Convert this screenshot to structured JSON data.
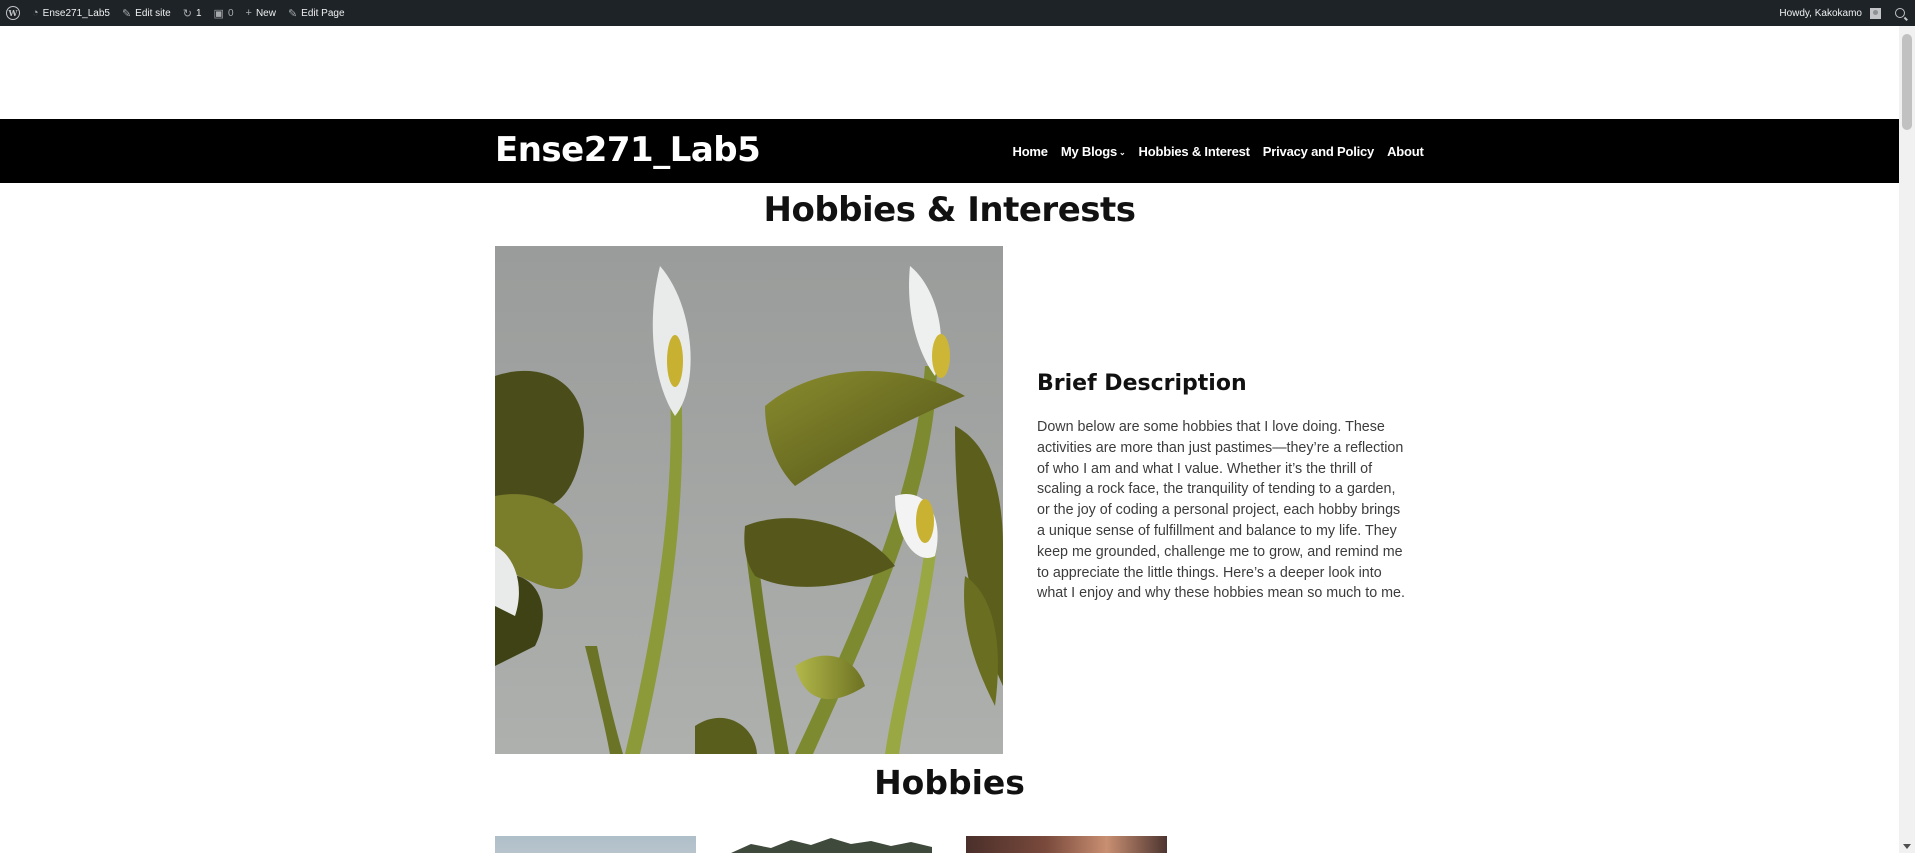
{
  "admin_bar": {
    "site_name": "Ense271_Lab5",
    "edit_site": "Edit site",
    "updates_count": "1",
    "comments_count": "0",
    "new_label": "New",
    "edit_page": "Edit Page",
    "greeting": "Howdy, Kakokamo"
  },
  "header": {
    "site_title": "Ense271_Lab5",
    "nav": [
      {
        "label": "Home"
      },
      {
        "label": "My Blogs"
      },
      {
        "label": "Hobbies & Interest"
      },
      {
        "label": "Privacy and Policy"
      },
      {
        "label": "About"
      }
    ]
  },
  "main": {
    "page_title": "Hobbies & Interests",
    "description_heading": "Brief Description",
    "description_text": "Down below are some hobbies that I love doing. These activities are more than just pastimes—they’re a reflection of who I am and what I value. Whether it’s the thrill of scaling a rock face, the tranquility of tending to a garden, or the joy of coding a personal project, each hobby brings a unique sense of fulfillment and balance to my life. They keep me grounded, challenge me to grow, and remind me to appreciate the little things. Here’s a deeper look into what I enjoy and why these hobbies mean so much to me.",
    "hobbies_title": "Hobbies"
  },
  "colors": {
    "admin_bar_bg": "#1d2327",
    "header_bg": "#000000",
    "text": "#111111"
  },
  "icons": [
    "wordpress-logo-icon",
    "dashboard-icon",
    "pencil-icon",
    "update-icon",
    "comment-icon",
    "plus-icon",
    "edit-icon",
    "avatar-icon",
    "search-icon"
  ]
}
